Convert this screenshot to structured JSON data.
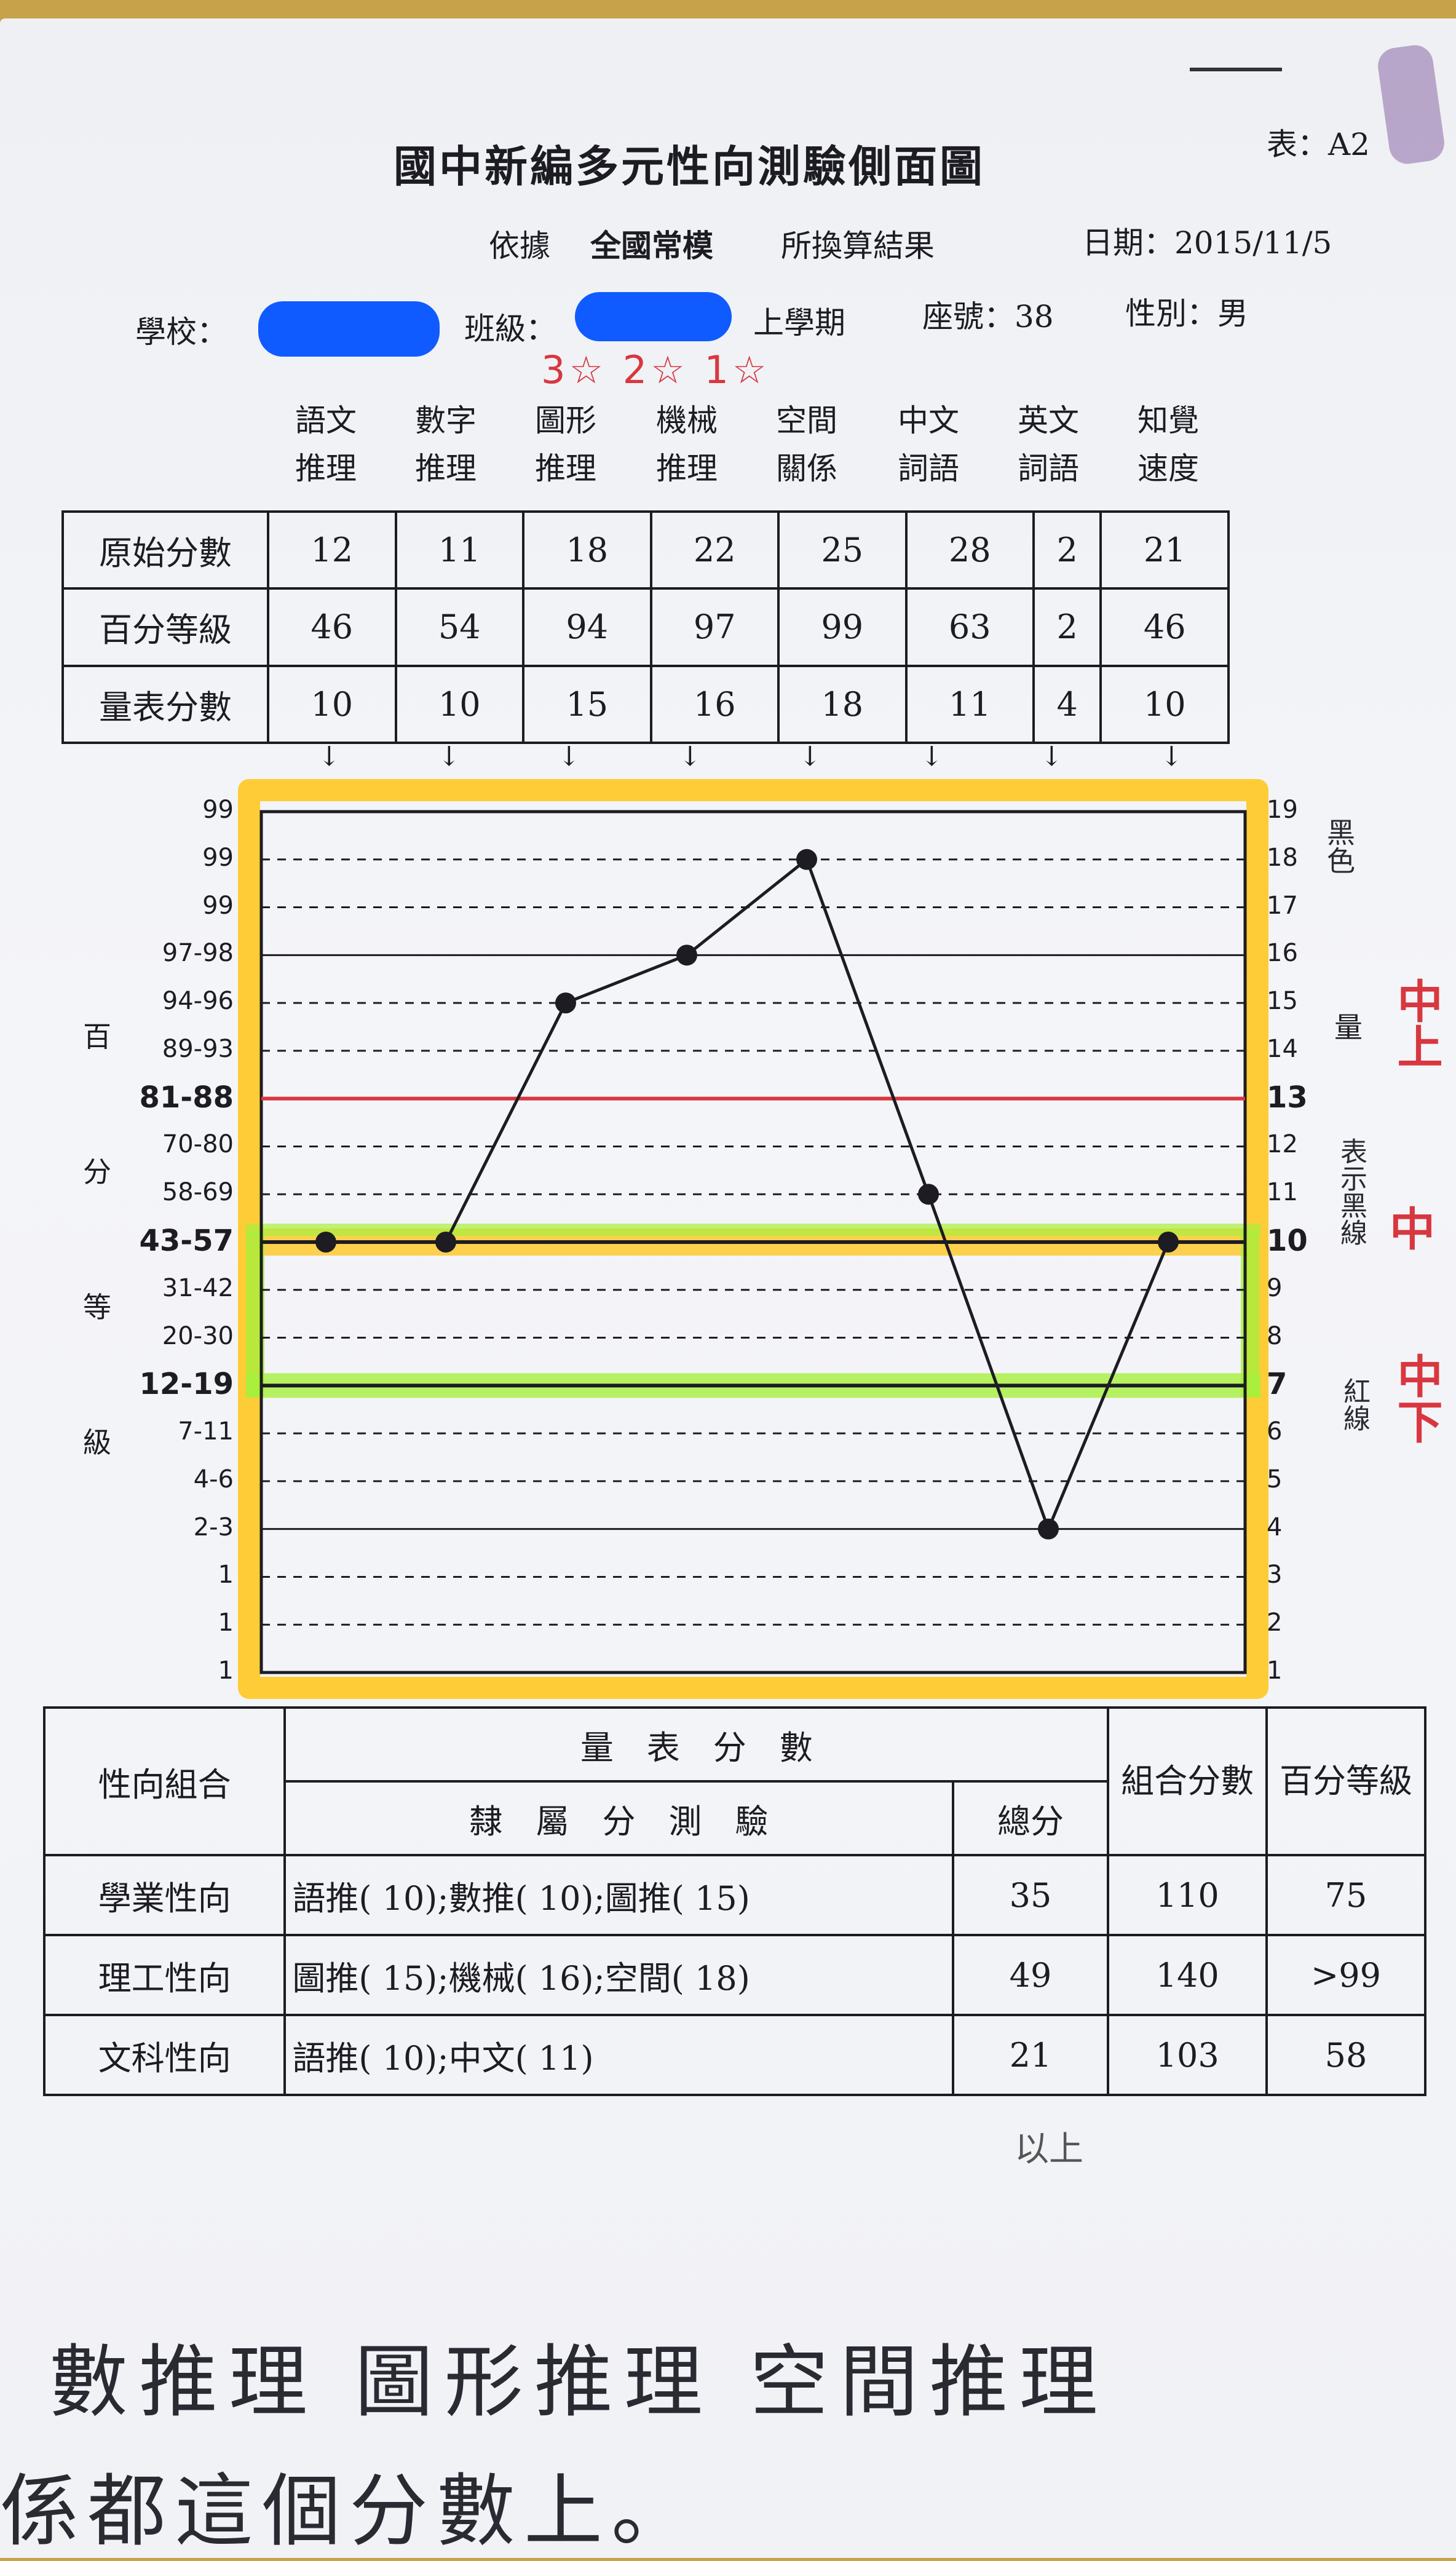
{
  "header": {
    "title": "國中新編多元性向測驗側面圖",
    "form_label": "表：A2",
    "basis_prefix": "依據",
    "basis_norm": "全國常模",
    "basis_suffix": "所換算結果",
    "date": "日期：2015/11/5",
    "school_label": "學校：",
    "class_label": "班級：",
    "semester": "上學期",
    "seat": "座號：38",
    "gender": "性別：男",
    "redaction_color": "#0f5bff"
  },
  "red_note": "3☆  2☆  1☆",
  "scores": {
    "columns": [
      {
        "l1": "語文",
        "l2": "推理"
      },
      {
        "l1": "數字",
        "l2": "推理"
      },
      {
        "l1": "圖形",
        "l2": "推理"
      },
      {
        "l1": "機械",
        "l2": "推理"
      },
      {
        "l1": "空間",
        "l2": "關係"
      },
      {
        "l1": "中文",
        "l2": "詞語"
      },
      {
        "l1": "英文",
        "l2": "詞語"
      },
      {
        "l1": "知覺",
        "l2": "速度"
      }
    ],
    "rows": [
      {
        "label": "原始分數",
        "values": [
          "12",
          "11",
          "18",
          "22",
          "25",
          "28",
          "2",
          "21"
        ]
      },
      {
        "label": "百分等級",
        "values": [
          "46",
          "54",
          "94",
          "97",
          "99",
          "63",
          "2",
          "46"
        ]
      },
      {
        "label": "量表分數",
        "values": [
          "10",
          "10",
          "15",
          "16",
          "18",
          "11",
          "4",
          "10"
        ]
      }
    ]
  },
  "chart_data": {
    "type": "line",
    "categories": [
      "語文推理",
      "數字推理",
      "圖形推理",
      "機械推理",
      "空間關係",
      "中文詞語",
      "英文詞語",
      "知覺速度"
    ],
    "series": [
      {
        "values": [
          10,
          10,
          15,
          16,
          18,
          11,
          4,
          10
        ]
      }
    ],
    "ylim": [
      1,
      19
    ],
    "left_axis_labels": [
      "99",
      "99",
      "99",
      "97-98",
      "94-96",
      "89-93",
      "81-88",
      "70-80",
      "58-69",
      "43-57",
      "31-42",
      "20-30",
      "12-19",
      "7-11",
      "4-6",
      "2-3",
      "1",
      "1",
      "1"
    ],
    "right_axis_labels": [
      "19",
      "18",
      "17",
      "16",
      "15",
      "14",
      "13",
      "12",
      "11",
      "10",
      "9",
      "8",
      "7",
      "6",
      "5",
      "4",
      "3",
      "2",
      "1"
    ],
    "left_axis_title": [
      "百",
      "分",
      "等",
      "級"
    ],
    "right_axis_title": "量",
    "bold_lines": [
      13,
      10,
      7
    ],
    "highlight_colors": {
      "outer": "#ffc414",
      "middle_band": "#a6f03c",
      "line_13": "#d8373f"
    },
    "margin_notes": {
      "upper": "中上",
      "middle": "中",
      "lower": "中下",
      "scribble_upper": "黑色",
      "scribble_middle": "表示黑線",
      "scribble_lower": "紅線"
    }
  },
  "combos": {
    "head_group": "性向組合",
    "head_scale": "量　表　分　數",
    "head_sub": "隸　屬　分　測　驗",
    "head_total": "總分",
    "head_combo": "組合分數",
    "head_pr": "百分等級",
    "rows": [
      {
        "name": "學業性向",
        "tests": "語推( 10);數推( 10);圖推( 15)",
        "total": "35",
        "combo": "110",
        "pr": "75"
      },
      {
        "name": "理工性向",
        "tests": "圖推( 15);機械( 16);空間( 18)",
        "total": "49",
        "combo": "140",
        "pr": ">99"
      },
      {
        "name": "文科性向",
        "tests": "語推( 10);中文( 11)",
        "total": "21",
        "combo": "103",
        "pr": "58"
      }
    ]
  },
  "handwriting": {
    "small": "以上",
    "line1": "數推理 圖形推理 空間推理",
    "line2": "係都這個分數上。"
  }
}
